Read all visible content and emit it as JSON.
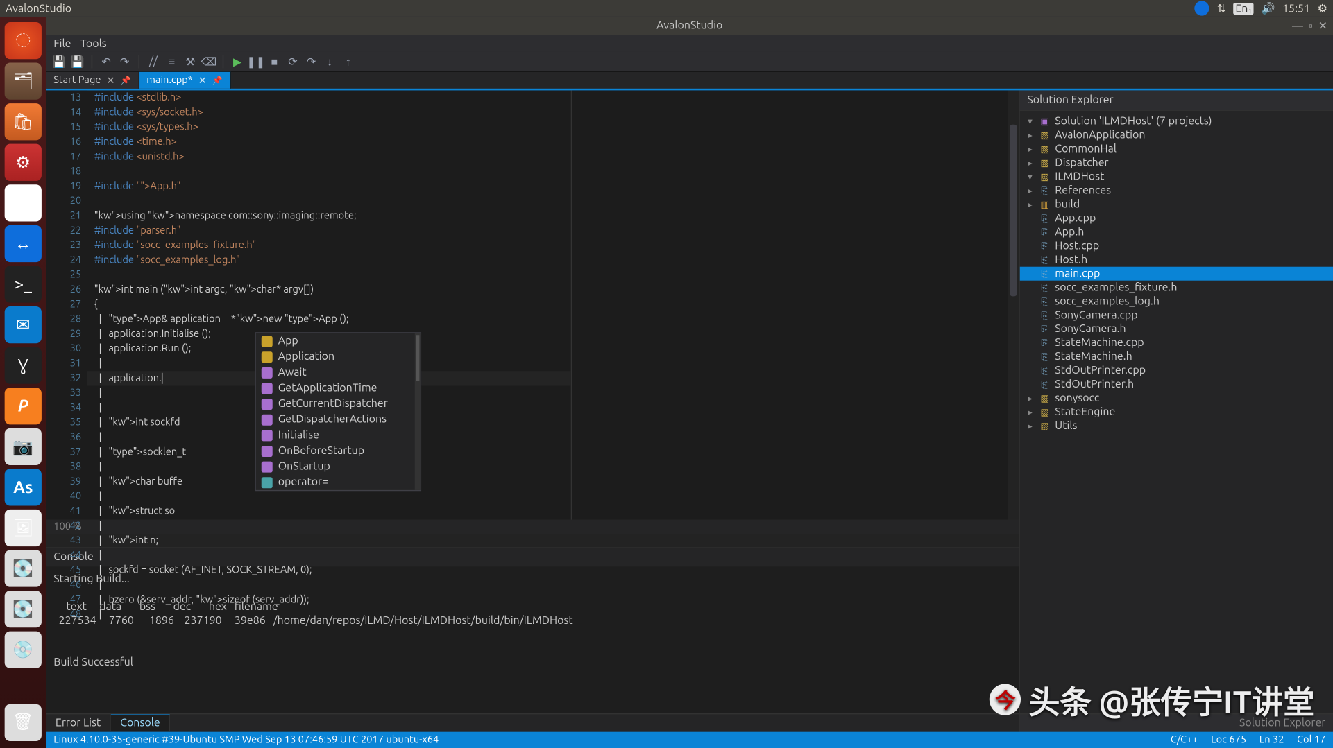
{
  "topbar": {
    "title": "AvalonStudio",
    "time": "15:51",
    "lang": "En₁"
  },
  "app": {
    "title": "AvalonStudio"
  },
  "menu": {
    "file": "File",
    "tools": "Tools"
  },
  "tabs": {
    "start": {
      "label": "Start Page"
    },
    "main": {
      "label": "main.cpp*"
    }
  },
  "editor": {
    "zoom": "100 %",
    "lines": [
      {
        "n": 13,
        "html": "#include <stdlib.h>"
      },
      {
        "n": 14,
        "html": "#include <sys/socket.h>"
      },
      {
        "n": 15,
        "html": "#include <sys/types.h>"
      },
      {
        "n": 16,
        "html": "#include <time.h>"
      },
      {
        "n": 17,
        "html": "#include <unistd.h>"
      },
      {
        "n": 18,
        "html": ""
      },
      {
        "n": 19,
        "html": "#include \"App.h\""
      },
      {
        "n": 20,
        "html": ""
      },
      {
        "n": 21,
        "html": "using namespace com::sony::imaging::remote;"
      },
      {
        "n": 22,
        "html": "#include \"parser.h\""
      },
      {
        "n": 23,
        "html": "#include \"socc_examples_fixture.h\""
      },
      {
        "n": 24,
        "html": "#include \"socc_examples_log.h\""
      },
      {
        "n": 25,
        "html": ""
      },
      {
        "n": 26,
        "html": "int main (int argc, char* argv[])"
      },
      {
        "n": 27,
        "html": "{"
      },
      {
        "n": 28,
        "html": "  |   App& application = *new App ();"
      },
      {
        "n": 29,
        "html": "  |   application.Initialise ();"
      },
      {
        "n": 30,
        "html": "  |   application.Run ();"
      },
      {
        "n": 31,
        "html": "  |"
      },
      {
        "n": 32,
        "html": "  |   application."
      },
      {
        "n": 33,
        "html": "  |"
      },
      {
        "n": 34,
        "html": "  |"
      },
      {
        "n": 35,
        "html": "  |   int sockfd"
      },
      {
        "n": 36,
        "html": "  |"
      },
      {
        "n": 37,
        "html": "  |   socklen_t"
      },
      {
        "n": 38,
        "html": "  |"
      },
      {
        "n": 39,
        "html": "  |   char buffe"
      },
      {
        "n": 40,
        "html": "  |"
      },
      {
        "n": 41,
        "html": "  |   struct so"
      },
      {
        "n": 42,
        "html": "  |"
      },
      {
        "n": 43,
        "html": "  |   int n;"
      },
      {
        "n": 44,
        "html": "  |"
      },
      {
        "n": 45,
        "html": "  |   sockfd = socket (AF_INET, SOCK_STREAM, 0);"
      },
      {
        "n": 46,
        "html": "  |"
      },
      {
        "n": 47,
        "html": "  |   bzero (&serv_addr, sizeof (serv_addr));"
      },
      {
        "n": 48,
        "html": "  |"
      }
    ],
    "autocomplete": [
      {
        "icon": "class",
        "label": "App"
      },
      {
        "icon": "class",
        "label": "Application"
      },
      {
        "icon": "func",
        "label": "Await"
      },
      {
        "icon": "func",
        "label": "GetApplicationTime"
      },
      {
        "icon": "func",
        "label": "GetCurrentDispatcher"
      },
      {
        "icon": "func",
        "label": "GetDispatcherActions"
      },
      {
        "icon": "func",
        "label": "Initialise"
      },
      {
        "icon": "func",
        "label": "OnBeforeStartup"
      },
      {
        "icon": "func",
        "label": "OnStartup"
      },
      {
        "icon": "op",
        "label": "operator="
      }
    ]
  },
  "console": {
    "title": "Console",
    "line1": "Starting Build...",
    "header": "     text     data       bss       dec       hex   filename",
    "row": "  227534     7760      1896    237190     39e86   /home/dan/repos/ILMD/Host/ILMDHost/build/bin/ILMDHost",
    "success": "Build Successful",
    "tabs": {
      "errorlist": "Error List",
      "console": "Console"
    }
  },
  "solution": {
    "title": "Solution Explorer",
    "root": "Solution 'ILMDHost' (7 projects)",
    "nodes": [
      {
        "lvl": 1,
        "exp": "▸",
        "icon": "proj",
        "label": "AvalonApplication"
      },
      {
        "lvl": 1,
        "exp": "▸",
        "icon": "proj",
        "label": "CommonHal"
      },
      {
        "lvl": 1,
        "exp": "▸",
        "icon": "proj",
        "label": "Dispatcher"
      },
      {
        "lvl": 1,
        "exp": "▾",
        "icon": "proj",
        "label": "ILMDHost"
      },
      {
        "lvl": 2,
        "exp": "▸",
        "icon": "ref",
        "label": "References"
      },
      {
        "lvl": 2,
        "exp": "▸",
        "icon": "fold",
        "label": "build"
      },
      {
        "lvl": 2,
        "exp": "",
        "icon": "cpp",
        "label": "App.cpp"
      },
      {
        "lvl": 2,
        "exp": "",
        "icon": "h",
        "label": "App.h"
      },
      {
        "lvl": 2,
        "exp": "",
        "icon": "cpp",
        "label": "Host.cpp"
      },
      {
        "lvl": 2,
        "exp": "",
        "icon": "h",
        "label": "Host.h"
      },
      {
        "lvl": 2,
        "exp": "",
        "icon": "cpp",
        "label": "main.cpp",
        "sel": true
      },
      {
        "lvl": 2,
        "exp": "",
        "icon": "h",
        "label": "socc_examples_fixture.h"
      },
      {
        "lvl": 2,
        "exp": "",
        "icon": "h",
        "label": "socc_examples_log.h"
      },
      {
        "lvl": 2,
        "exp": "",
        "icon": "cpp",
        "label": "SonyCamera.cpp"
      },
      {
        "lvl": 2,
        "exp": "",
        "icon": "h",
        "label": "SonyCamera.h"
      },
      {
        "lvl": 2,
        "exp": "",
        "icon": "cpp",
        "label": "StateMachine.cpp"
      },
      {
        "lvl": 2,
        "exp": "",
        "icon": "h",
        "label": "StateMachine.h"
      },
      {
        "lvl": 2,
        "exp": "",
        "icon": "cpp",
        "label": "StdOutPrinter.cpp"
      },
      {
        "lvl": 2,
        "exp": "",
        "icon": "h",
        "label": "StdOutPrinter.h"
      },
      {
        "lvl": 1,
        "exp": "▸",
        "icon": "proj",
        "label": "sonysocc"
      },
      {
        "lvl": 1,
        "exp": "▸",
        "icon": "proj",
        "label": "StateEngine"
      },
      {
        "lvl": 1,
        "exp": "▸",
        "icon": "proj",
        "label": "Utils"
      }
    ],
    "foot": "Solution Explorer"
  },
  "status": {
    "left": "Linux 4.10.0-35-generic #39-Ubuntu SMP Wed Sep 13 07:46:59 UTC 2017 ubuntu-x64",
    "lang": "C/C++",
    "loc": "Loc 675",
    "ln": "Ln 32",
    "col": "Col 17"
  },
  "watermark": "头条 @张传宁IT讲堂"
}
